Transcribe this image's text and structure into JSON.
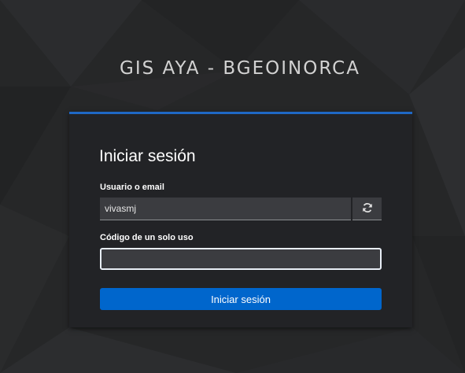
{
  "site": {
    "title": "GIS AYA - BGEOINORCA"
  },
  "login": {
    "heading": "Iniciar sesión",
    "username_label": "Usuario o email",
    "username_value": "vivasmj",
    "reset_icon": "refresh-icon",
    "otp_label": "Código de un solo uso",
    "otp_value": "",
    "submit_label": "Iniciar sesión"
  },
  "colors": {
    "background": "#262728",
    "card": "#222326",
    "accent_top": "#1f68c5",
    "primary_button": "#0066cc",
    "input": "#3b3c40"
  }
}
